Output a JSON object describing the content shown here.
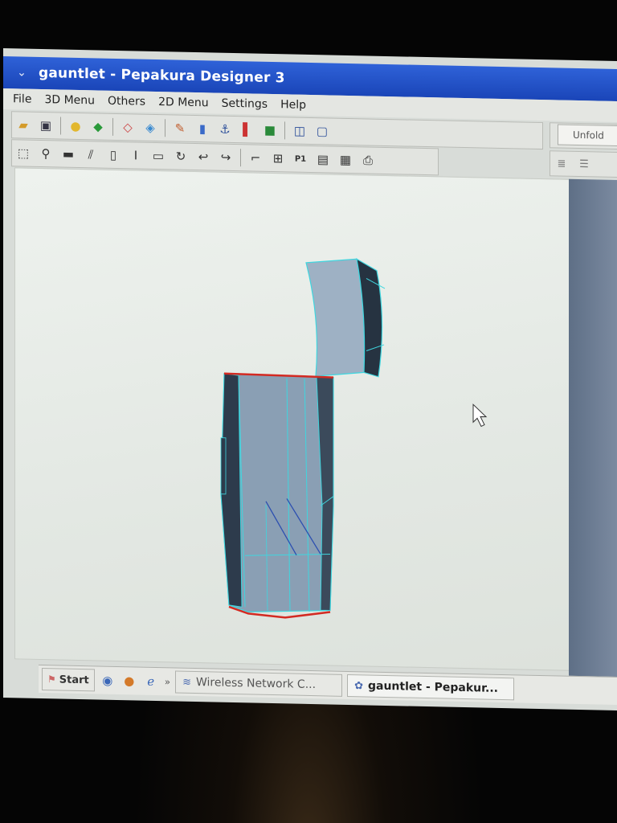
{
  "window": {
    "title": "gauntlet - Pepakura Designer 3"
  },
  "menu": [
    "File",
    "3D Menu",
    "Others",
    "2D Menu",
    "Settings",
    "Help"
  ],
  "toolbar_right": {
    "unfold_label": "Unfold"
  },
  "taskbar": {
    "start_label": "Start",
    "items": [
      {
        "label": "Wireless Network C..."
      },
      {
        "label": "gauntlet - Pepakur..."
      }
    ]
  },
  "colors": {
    "titlebar": "#2456c9",
    "model_face": "#8a9fb4",
    "model_edge": "#3fd6df",
    "cut_edge": "#d32a22"
  }
}
